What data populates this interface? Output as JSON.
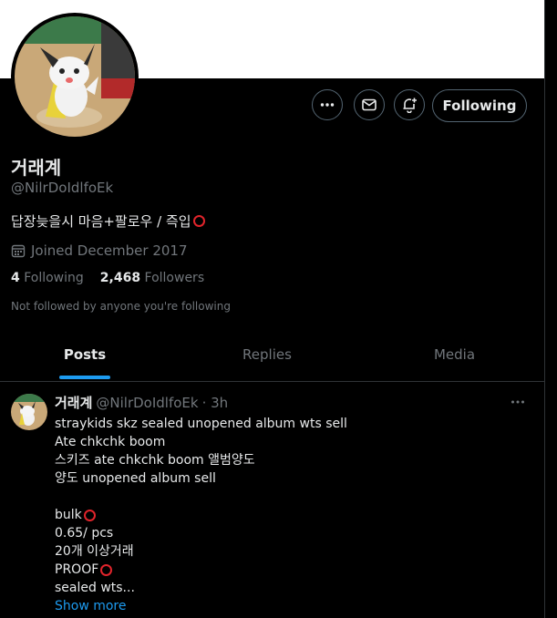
{
  "profile": {
    "name": "거래계",
    "handle": "@NilrDoIdlfoEk",
    "bio": "답장늦을시 마음+팔로우 / 즉입",
    "joined": "Joined December 2017",
    "following_count": "4",
    "following_label": "Following",
    "followers_count": "2,468",
    "followers_label": "Followers",
    "not_followed": "Not followed by anyone you're following"
  },
  "actions": {
    "more_icon": "more-dots-icon",
    "message_icon": "mail-icon",
    "notify_icon": "bell-plus-icon",
    "follow_label": "Following"
  },
  "tabs": [
    {
      "label": "Posts"
    },
    {
      "label": "Replies"
    },
    {
      "label": "Media"
    }
  ],
  "tweet": {
    "name": "거래계",
    "handle": "@NilrDoIdlfoEk",
    "time": "· 3h",
    "lines": [
      "straykids skz sealed unopened album wts sell",
      "Ate chkchk boom",
      "스키즈 ate chkchk boom 앨범양도",
      "양도 unopened album sell",
      "",
      "bulk",
      "0.65/ pcs",
      "20개 이상거래",
      "PROOF",
      "sealed wts..."
    ],
    "show_more": "Show more"
  },
  "colors": {
    "accent": "#1d9bf0",
    "ring_red": "#e0242b",
    "muted": "#71767b"
  }
}
